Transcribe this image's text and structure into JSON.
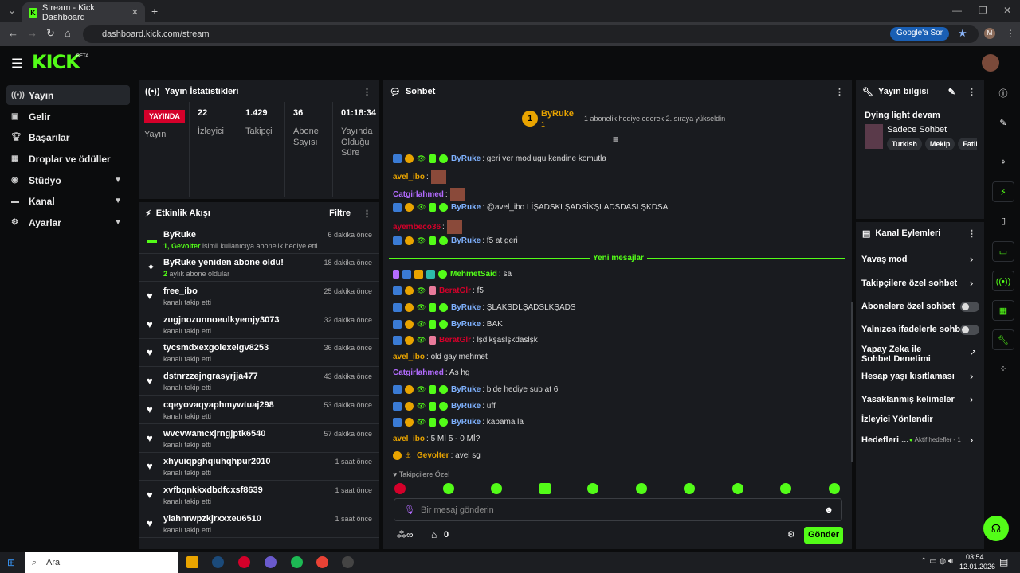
{
  "browser": {
    "tab_title": "Stream - Kick Dashboard",
    "url": "dashboard.kick.com/stream",
    "google_ask": "Google'a Sor",
    "profile_initial": "M"
  },
  "brand": {
    "logo": "KICK",
    "beta": "BETA",
    "accent": "#53fc18"
  },
  "sidebar": {
    "items": [
      {
        "label": "Yayın",
        "icon": "broadcast-icon"
      },
      {
        "label": "Gelir",
        "icon": "revenue-icon"
      },
      {
        "label": "Başarılar",
        "icon": "trophy-icon"
      },
      {
        "label": "Droplar ve ödüller",
        "icon": "gift-icon"
      },
      {
        "label": "Stüdyo",
        "icon": "studio-icon"
      },
      {
        "label": "Kanal",
        "icon": "channel-icon"
      },
      {
        "label": "Ayarlar",
        "icon": "gear-icon"
      }
    ]
  },
  "stats": {
    "title": "Yayın İstatistikleri",
    "live_badge": "YAYINDA",
    "live_label": "Yayın",
    "viewers": "22",
    "viewers_label": "İzleyici",
    "followers": "1.429",
    "followers_label": "Takipçi",
    "subs": "36",
    "subs_label": "Abone Sayısı",
    "uptime": "01:18:34",
    "uptime_label": "Yayında Olduğu Süre"
  },
  "activity": {
    "title": "Etkinlik Akışı",
    "filter": "Filtre",
    "items": [
      {
        "name": "ByRuke",
        "sub_pre": "1, Gevolter",
        "sub": " isimli kullanıcıya abonelik hediye etti.",
        "time": "6 dakika önce"
      },
      {
        "name": "ByRuke yeniden abone oldu!",
        "sub_pre": "2",
        "sub": " aylık abone oldular",
        "time": "18 dakika önce"
      },
      {
        "name": "free_ibo",
        "sub_pre": "",
        "sub": "kanalı takip etti",
        "time": "25 dakika önce"
      },
      {
        "name": "zugjnozunnoeulkyemjy3073",
        "sub_pre": "",
        "sub": "kanalı takip etti",
        "time": "32 dakika önce"
      },
      {
        "name": "tycsmdxexgolexelgv8253",
        "sub_pre": "",
        "sub": "kanalı takip etti",
        "time": "36 dakika önce"
      },
      {
        "name": "dstnrzzejngrasyrjja477",
        "sub_pre": "",
        "sub": "kanalı takip etti",
        "time": "43 dakika önce"
      },
      {
        "name": "cqeyovaqyaphmywtuaj298",
        "sub_pre": "",
        "sub": "kanalı takip etti",
        "time": "53 dakika önce"
      },
      {
        "name": "wvcvwamcxjrngjptk6540",
        "sub_pre": "",
        "sub": "kanalı takip etti",
        "time": "57 dakika önce"
      },
      {
        "name": "xhyuiqpghqiuhqhpur2010",
        "sub_pre": "",
        "sub": "kanalı takip etti",
        "time": "1 saat önce"
      },
      {
        "name": "xvfbqnkkxdbdfcxsf8639",
        "sub_pre": "",
        "sub": "kanalı takip etti",
        "time": "1 saat önce"
      },
      {
        "name": "ylahnrwpzkjrxxxeu6510",
        "sub_pre": "",
        "sub": "kanalı takip etti",
        "time": "1 saat önce"
      }
    ]
  },
  "chat": {
    "title": "Sohbet",
    "pinned_user": "ByRuke",
    "pinned_rank": "1",
    "pinned_count": "1",
    "pinned_msg": "1 abonelik hediye ederek 2. sıraya yükseldin",
    "new_messages": "Yeni mesajlar",
    "followers_only": "Takipçilere Özel",
    "placeholder": "Bir mesaj gönderin",
    "send": "Gönder",
    "points": "0",
    "messages": [
      {
        "user": "ByRuke",
        "color": "#7fb2ff",
        "text": ": geri ver modlugu kendine komutla",
        "badges": "full"
      },
      {
        "user": "avel_ibo",
        "color": "#e9a400",
        "text": ":",
        "emote": true,
        "badges": "none"
      },
      {
        "user": "Catgirlahmed",
        "color": "#b36bff",
        "text": ":",
        "emote": true,
        "badges": "none"
      },
      {
        "user": "ByRuke",
        "color": "#7fb2ff",
        "text": ": @avel_ibo LİŞADSKLŞADSİKŞLADSDASLŞKDSA",
        "badges": "full"
      },
      {
        "user": "ayembeco36",
        "color": "#d4002a",
        "text": ":",
        "emote": true,
        "badges": "none"
      },
      {
        "user": "ByRuke",
        "color": "#7fb2ff",
        "text": ": f5 at geri",
        "badges": "full"
      },
      {
        "user": "MehmetSaid",
        "color": "#53fc18",
        "text": ": sa",
        "badges": "mod"
      },
      {
        "user": "BeratGlr",
        "color": "#d4002a",
        "text": ": f5",
        "badges": "pink"
      },
      {
        "user": "ByRuke",
        "color": "#7fb2ff",
        "text": ": ŞLAKSDLŞADSLKŞADS",
        "badges": "full"
      },
      {
        "user": "ByRuke",
        "color": "#7fb2ff",
        "text": ": BAK",
        "badges": "full"
      },
      {
        "user": "BeratGlr",
        "color": "#d4002a",
        "text": ": lşdlkşaslşkdaslşk",
        "badges": "pink"
      },
      {
        "user": "avel_ibo",
        "color": "#e9a400",
        "text": ": old gay mehmet",
        "badges": "none"
      },
      {
        "user": "Catgirlahmed",
        "color": "#b36bff",
        "text": ": As hg",
        "badges": "none"
      },
      {
        "user": "ByRuke",
        "color": "#7fb2ff",
        "text": ": bide hediye sub at 6",
        "badges": "full"
      },
      {
        "user": "ByRuke",
        "color": "#7fb2ff",
        "text": ": üff",
        "badges": "full"
      },
      {
        "user": "ByRuke",
        "color": "#7fb2ff",
        "text": ": kapama la",
        "badges": "full"
      },
      {
        "user": "avel_ibo",
        "color": "#e9a400",
        "text": ": 5 Mİ 5 - 0 Mİ?",
        "badges": "none"
      },
      {
        "user": "Gevolter",
        "color": "#e9a400",
        "text": ": avel sg",
        "badges": "gold"
      }
    ]
  },
  "stream_info": {
    "title": "Yayın bilgisi",
    "stream_title": "Dying light devam",
    "category": "Sadece Sohbet",
    "tags": [
      "Turkish",
      "Mekip",
      "FatihT"
    ]
  },
  "channel_actions": {
    "title": "Kanal Eylemleri",
    "slow": "Yavaş mod",
    "followers_chat": "Takipçilere özel sohbet",
    "subs_chat": "Abonelere özel sohbet",
    "emote_only": "Yalnızca ifadelerle sohbet",
    "ai": "Yapay Zeka ile Sohbet Denetimi",
    "age": "Hesap yaşı kısıtlaması",
    "banned": "Yasaklanmış kelimeler",
    "redirect": "İzleyici Yönlendir",
    "goals": "Hedefleri ...",
    "goals_status": "Aktif hedefler - 1"
  },
  "taskbar": {
    "search": "Ara",
    "time": "03:54",
    "date": "12.01.2026"
  }
}
